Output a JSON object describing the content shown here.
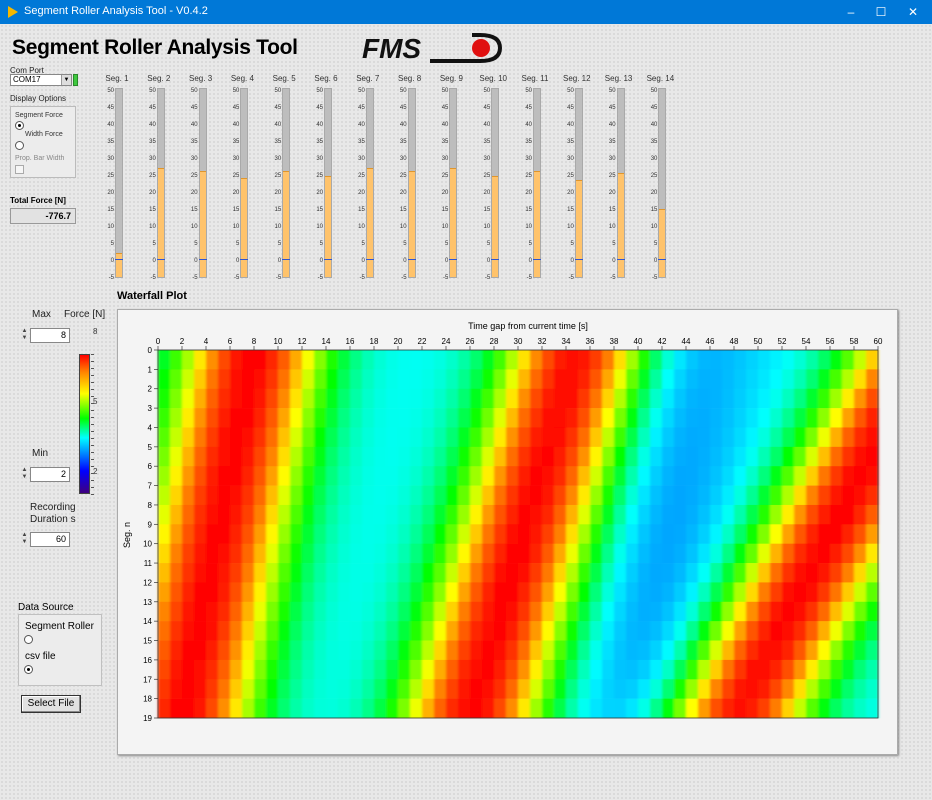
{
  "window": {
    "title": "Segment Roller Analysis Tool - V0.4.2",
    "controls": {
      "minimize": "–",
      "maximize": "☐",
      "close": "✕"
    }
  },
  "header": {
    "title": "Segment Roller Analysis Tool",
    "logo_text": "FMS"
  },
  "left_panel": {
    "com_port_label": "Com Port",
    "com_port_value": "COM17",
    "display_options_label": "Display Options",
    "display_options": [
      {
        "label": "Segment Force",
        "type": "label"
      },
      {
        "label": "Width Force",
        "type": "radio",
        "selected": false
      },
      {
        "label": "Prop. Bar Width",
        "type": "check",
        "checked": false
      }
    ],
    "total_force_label": "Total Force [N]",
    "total_force_value": "-776.7"
  },
  "segments": {
    "scale_ticks": [
      "50",
      "45",
      "40",
      "35",
      "30",
      "25",
      "20",
      "15",
      "10",
      "5",
      "0",
      "-5"
    ],
    "scale_min": -5,
    "scale_max": 50,
    "bars": [
      {
        "label": "Seg. 1",
        "value": 2
      },
      {
        "label": "Seg. 2",
        "value": 27
      },
      {
        "label": "Seg. 3",
        "value": 26
      },
      {
        "label": "Seg. 4",
        "value": 24
      },
      {
        "label": "Seg. 5",
        "value": 26
      },
      {
        "label": "Seg. 6",
        "value": 24.5
      },
      {
        "label": "Seg. 7",
        "value": 27
      },
      {
        "label": "Seg. 8",
        "value": 26
      },
      {
        "label": "Seg. 9",
        "value": 27
      },
      {
        "label": "Seg. 10",
        "value": 24.5
      },
      {
        "label": "Seg. 11",
        "value": 26
      },
      {
        "label": "Seg. 12",
        "value": 23.5
      },
      {
        "label": "Seg. 13",
        "value": 25.5
      },
      {
        "label": "Seg. 14",
        "value": 15
      }
    ]
  },
  "scale_controls": {
    "max_label": "Max",
    "max_value": "8",
    "force_label": "Force [N]",
    "colorbar_ticks": [
      "8",
      "5",
      "2"
    ],
    "min_label": "Min",
    "min_value": "2",
    "recording_label_1": "Recording",
    "recording_label_2": "Duration s",
    "recording_value": "60",
    "spinner_up": "▲",
    "spinner_down": "▼"
  },
  "data_source": {
    "label": "Data Source",
    "options": [
      {
        "label": "Segment Roller",
        "selected": false
      },
      {
        "label": "csv file",
        "selected": true
      }
    ],
    "select_file_label": "Select File"
  },
  "waterfall": {
    "label": "Waterfall Plot",
    "colors": [
      "#ff0000",
      "#ff8000",
      "#ffff00",
      "#00ff00",
      "#00ffff"
    ]
  },
  "chart_data": {
    "type": "heatmap",
    "xlabel": "Time gap from current time [s]",
    "ylabel": "Seg. n",
    "x_ticks": [
      0,
      2,
      4,
      6,
      8,
      10,
      12,
      14,
      16,
      18,
      20,
      22,
      24,
      26,
      28,
      30,
      32,
      34,
      36,
      38,
      40,
      42,
      44,
      46,
      48,
      50,
      52,
      54,
      56,
      58,
      60
    ],
    "y_ticks": [
      0,
      1,
      2,
      3,
      4,
      5,
      6,
      7,
      8,
      9,
      10,
      11,
      12,
      13,
      14,
      15,
      16,
      17,
      18,
      19
    ],
    "xlim": [
      0,
      60
    ],
    "ylim": [
      0,
      19
    ],
    "zlim": [
      2,
      8
    ],
    "colorscale": "red(high)-yellow-green-cyan-blue(low)",
    "bands": [
      {
        "description": "high-force band",
        "x_at_seg0": 8,
        "x_at_seg19": 2,
        "z_peak": 8
      },
      {
        "description": "high-force band",
        "x_at_seg0": 35,
        "x_at_seg19": 26,
        "z_peak": 8
      },
      {
        "description": "high-force band",
        "x_at_seg0": 64,
        "x_at_seg19": 48,
        "z_peak": 8
      }
    ],
    "baseline_z": 4
  }
}
